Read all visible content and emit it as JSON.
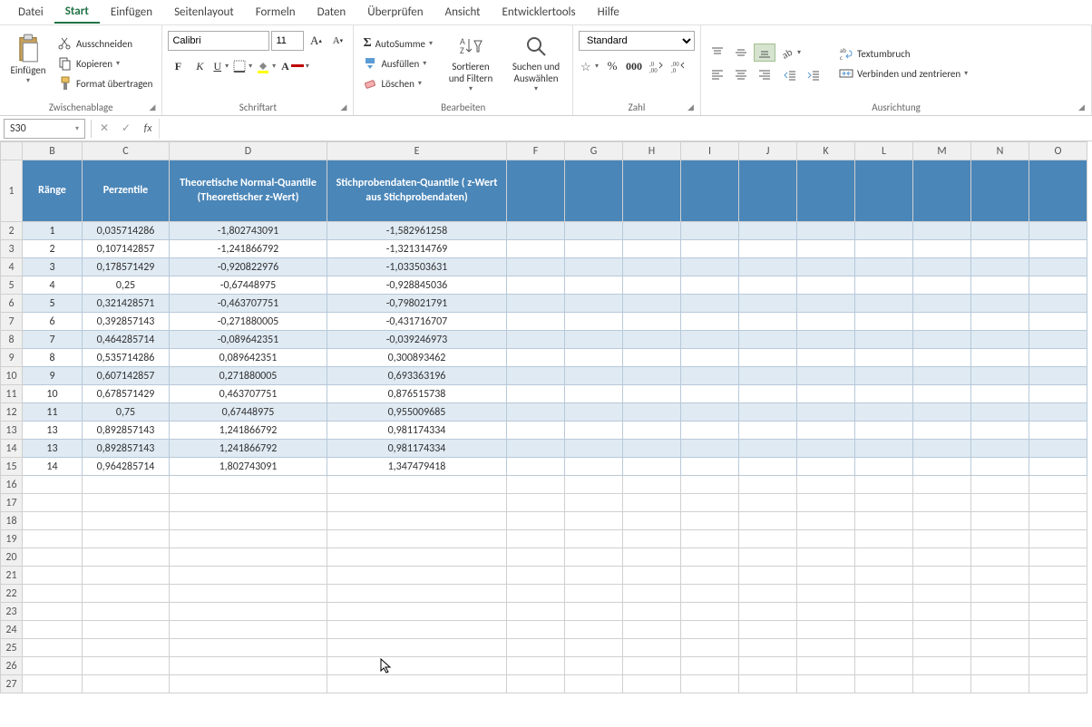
{
  "menu": {
    "items": [
      "Datei",
      "Start",
      "Einfügen",
      "Seitenlayout",
      "Formeln",
      "Daten",
      "Überprüfen",
      "Ansicht",
      "Entwicklertools",
      "Hilfe"
    ],
    "active": 1
  },
  "ribbon": {
    "clipboard": {
      "label": "Zwischenablage",
      "paste": "Einfügen",
      "cut": "Ausschneiden",
      "copy": "Kopieren",
      "format": "Format übertragen"
    },
    "font": {
      "label": "Schriftart",
      "name": "Calibri",
      "size": "11"
    },
    "editing": {
      "label": "Bearbeiten",
      "autosum": "AutoSumme",
      "fill": "Ausfüllen",
      "clear": "Löschen",
      "sort": "Sortieren und Filtern",
      "find": "Suchen und Auswählen"
    },
    "number": {
      "label": "Zahl",
      "format": "Standard"
    },
    "alignment": {
      "label": "Ausrichtung",
      "wrap": "Textumbruch",
      "merge": "Verbinden und zentrieren"
    }
  },
  "formula_bar": {
    "cell_ref": "S30",
    "formula": ""
  },
  "columns": [
    "B",
    "C",
    "D",
    "E",
    "F",
    "G",
    "H",
    "I",
    "J",
    "K",
    "L",
    "M",
    "N",
    "O"
  ],
  "headers": {
    "B": "Ränge",
    "C": "Perzentile",
    "D": "Theoretische Normal-Quantile (Theoretischer z-Wert)",
    "E": "Stichprobendaten-Quantile ( z-Wert aus Stichprobendaten)"
  },
  "rows": [
    {
      "r": 2,
      "B": "1",
      "C": "0,035714286",
      "D": "-1,802743091",
      "E": "-1,582961258"
    },
    {
      "r": 3,
      "B": "2",
      "C": "0,107142857",
      "D": "-1,241866792",
      "E": "-1,321314769"
    },
    {
      "r": 4,
      "B": "3",
      "C": "0,178571429",
      "D": "-0,920822976",
      "E": "-1,033503631"
    },
    {
      "r": 5,
      "B": "4",
      "C": "0,25",
      "D": "-0,67448975",
      "E": "-0,928845036"
    },
    {
      "r": 6,
      "B": "5",
      "C": "0,321428571",
      "D": "-0,463707751",
      "E": "-0,798021791"
    },
    {
      "r": 7,
      "B": "6",
      "C": "0,392857143",
      "D": "-0,271880005",
      "E": "-0,431716707"
    },
    {
      "r": 8,
      "B": "7",
      "C": "0,464285714",
      "D": "-0,089642351",
      "E": "-0,039246973"
    },
    {
      "r": 9,
      "B": "8",
      "C": "0,535714286",
      "D": "0,089642351",
      "E": "0,300893462"
    },
    {
      "r": 10,
      "B": "9",
      "C": "0,607142857",
      "D": "0,271880005",
      "E": "0,693363196"
    },
    {
      "r": 11,
      "B": "10",
      "C": "0,678571429",
      "D": "0,463707751",
      "E": "0,876515738"
    },
    {
      "r": 12,
      "B": "11",
      "C": "0,75",
      "D": "0,67448975",
      "E": "0,955009685"
    },
    {
      "r": 13,
      "B": "13",
      "C": "0,892857143",
      "D": "1,241866792",
      "E": "0,981174334"
    },
    {
      "r": 14,
      "B": "13",
      "C": "0,892857143",
      "D": "1,241866792",
      "E": "0,981174334"
    },
    {
      "r": 15,
      "B": "14",
      "C": "0,964285714",
      "D": "1,802743091",
      "E": "1,347479418"
    }
  ],
  "chart_data": {
    "type": "table",
    "title": "Q-Q Plot Data",
    "columns": [
      "Ränge",
      "Perzentile",
      "Theoretische Normal-Quantile (Theoretischer z-Wert)",
      "Stichprobendaten-Quantile (z-Wert aus Stichprobendaten)"
    ],
    "data": [
      [
        1,
        0.035714286,
        -1.802743091,
        -1.582961258
      ],
      [
        2,
        0.107142857,
        -1.241866792,
        -1.321314769
      ],
      [
        3,
        0.178571429,
        -0.920822976,
        -1.033503631
      ],
      [
        4,
        0.25,
        -0.67448975,
        -0.928845036
      ],
      [
        5,
        0.321428571,
        -0.463707751,
        -0.798021791
      ],
      [
        6,
        0.392857143,
        -0.271880005,
        -0.431716707
      ],
      [
        7,
        0.464285714,
        -0.089642351,
        -0.039246973
      ],
      [
        8,
        0.535714286,
        0.089642351,
        0.300893462
      ],
      [
        9,
        0.607142857,
        0.271880005,
        0.693363196
      ],
      [
        10,
        0.678571429,
        0.463707751,
        0.876515738
      ],
      [
        11,
        0.75,
        0.67448975,
        0.955009685
      ],
      [
        13,
        0.892857143,
        1.241866792,
        0.981174334
      ],
      [
        13,
        0.892857143,
        1.241866792,
        0.981174334
      ],
      [
        14,
        0.964285714,
        1.802743091,
        1.347479418
      ]
    ]
  }
}
